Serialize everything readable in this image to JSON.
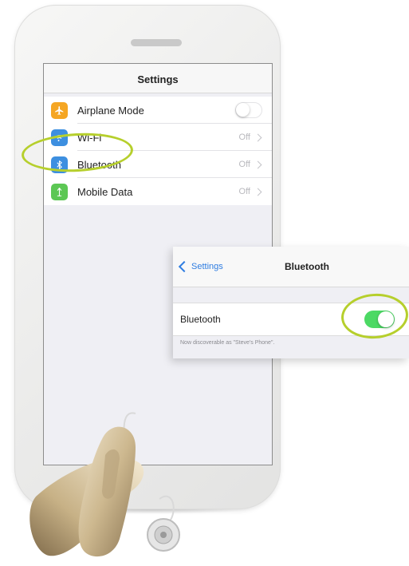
{
  "screen": {
    "title": "Settings",
    "rows": [
      {
        "label": "Airplane Mode",
        "value": "",
        "icon": "airplane-icon",
        "icon_color": "#f5a623",
        "control": "toggle-off"
      },
      {
        "label": "Wi-Fi",
        "value": "Off",
        "icon": "wifi-icon",
        "icon_color": "#3d8fe0",
        "control": "chevron"
      },
      {
        "label": "Bluetooth",
        "value": "Off",
        "icon": "bluetooth-icon",
        "icon_color": "#3d8fe0",
        "control": "chevron"
      },
      {
        "label": "Mobile Data",
        "value": "Off",
        "icon": "mobile-data-icon",
        "icon_color": "#5cc754",
        "control": "chevron"
      }
    ]
  },
  "popup": {
    "back_label": "Settings",
    "title": "Bluetooth",
    "row_label": "Bluetooth",
    "toggle_state": "on",
    "note": "Now discoverable as \"Steve's Phone\"."
  },
  "colors": {
    "highlight": "#b6cf2c",
    "toggle_on": "#4cd964",
    "ios_blue": "#2f7de1"
  }
}
